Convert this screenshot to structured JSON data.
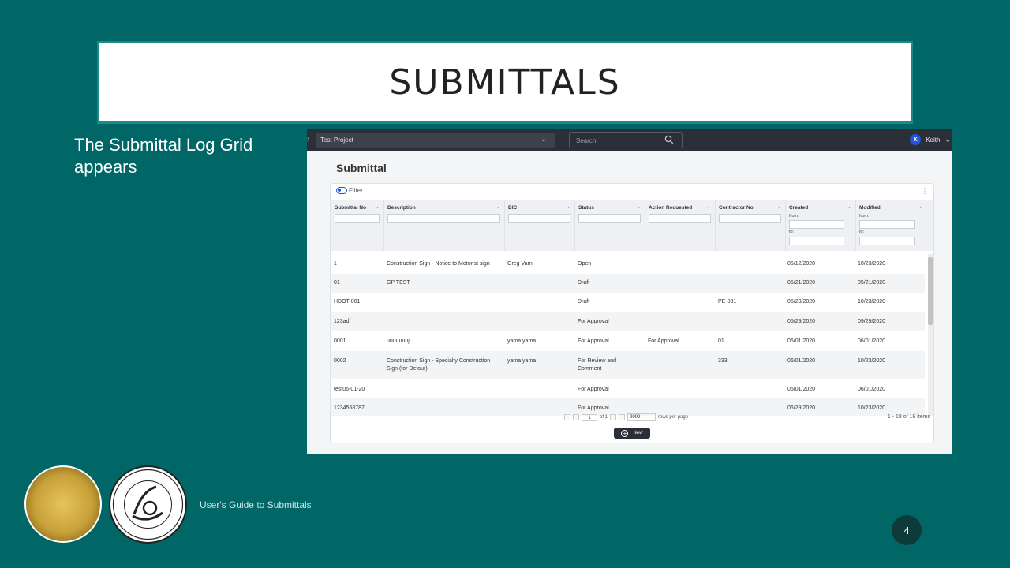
{
  "slide": {
    "title": "SUBMITTALS",
    "caption": "The Submittal Log Grid appears",
    "footer": "User's Guide to Submittals",
    "page_number": "4"
  },
  "app": {
    "project_label": "Test Project",
    "search_placeholder": "Search",
    "user_initial": "K",
    "user_name": "Keith",
    "page_title": "Submittal",
    "filter_label": "Filter",
    "from_label": "from:",
    "to_label": "to:",
    "columns": [
      "Submittal No",
      "Description",
      "BIC",
      "Status",
      "Action Requested",
      "Contractor No",
      "Created",
      "Modified"
    ],
    "rows": [
      {
        "no": "1",
        "desc": "Construction Sign - Notice to Motorist sign",
        "bic": "Greg Varni",
        "status": "Open",
        "action": "",
        "contractor": "",
        "created": "05/12/2020",
        "modified": "10/23/2020"
      },
      {
        "no": "01",
        "desc": "GP TEST",
        "bic": "",
        "status": "Draft",
        "action": "",
        "contractor": "",
        "created": "05/21/2020",
        "modified": "05/21/2020"
      },
      {
        "no": "HDOT-001",
        "desc": "",
        "bic": "",
        "status": "Draft",
        "action": "",
        "contractor": "PE-001",
        "created": "05/28/2020",
        "modified": "10/23/2020"
      },
      {
        "no": "123adf",
        "desc": "",
        "bic": "",
        "status": "For Approval",
        "action": "",
        "contractor": "",
        "created": "05/29/2020",
        "modified": "09/29/2020"
      },
      {
        "no": "0001",
        "desc": "uuuuuuuj",
        "bic": "yama yama",
        "status": "For Approval",
        "action": "For Approval",
        "contractor": "01",
        "created": "06/01/2020",
        "modified": "06/01/2020"
      },
      {
        "no": "0002",
        "desc": "Construction Sign - Specialty Construction Sign (for Detour)",
        "bic": "yama yama",
        "status": "For Review and Comment",
        "action": "",
        "contractor": "333",
        "created": "06/01/2020",
        "modified": "10/23/2020"
      },
      {
        "no": "test06-01-20",
        "desc": "",
        "bic": "",
        "status": "For Approval",
        "action": "",
        "contractor": "",
        "created": "06/01/2020",
        "modified": "06/01/2020"
      },
      {
        "no": "1234568787",
        "desc": "",
        "bic": "",
        "status": "For Approval",
        "action": "",
        "contractor": "",
        "created": "06/29/2020",
        "modified": "10/23/2020"
      }
    ],
    "pager": {
      "page": "1",
      "of_label": "of 1",
      "page_size": "9999",
      "rows_label": "rows per page",
      "items_label": "1 - 18 of 18 items"
    },
    "new_label": "New"
  }
}
